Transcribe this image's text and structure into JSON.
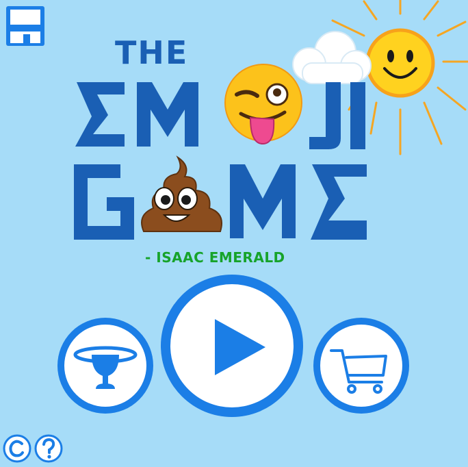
{
  "title": {
    "the": "THE",
    "word1": "EMOJI",
    "word2": "GAME"
  },
  "author": "- ISAAC EMERALD",
  "icons": {
    "save": "floppy-disk-icon",
    "sun": "smiling-sun-icon",
    "cloud": "cloud-icon",
    "wink": "winking-tongue-emoji-icon",
    "poop": "pile-of-poo-emoji-icon",
    "trophy": "trophy-icon",
    "play": "play-icon",
    "cart": "shopping-cart-icon",
    "credits": "copyright-icon",
    "help": "question-mark-icon"
  },
  "colors": {
    "background": "#a6dcf8",
    "title_blue": "#1a5fb4",
    "button_blue": "#1b7ee6",
    "author_green": "#17a32a",
    "sun_yellow": "#ffd21f"
  }
}
